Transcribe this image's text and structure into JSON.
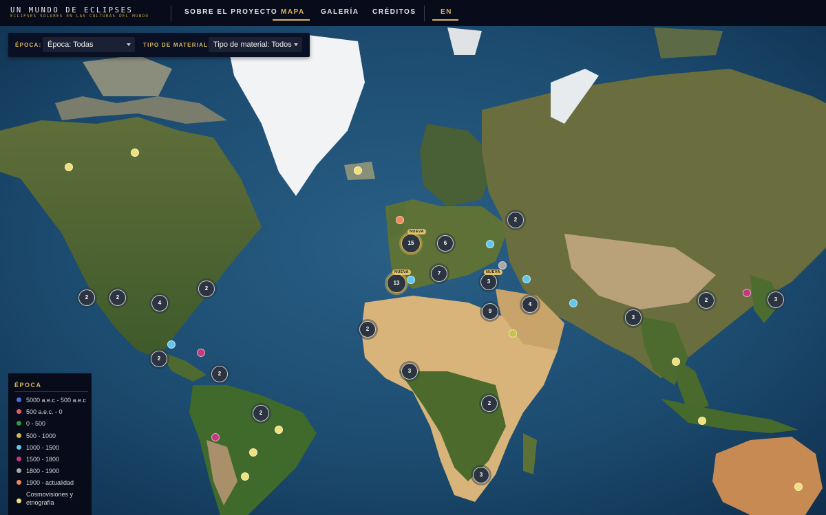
{
  "header": {
    "title": "UN MUNDO DE ECLIPSES",
    "subtitle": "ECLIPSES SOLARES EN LAS CULTURAS DEL MUNDO",
    "nav": {
      "about": "SOBRE EL PROYECTO",
      "map": "MAPA",
      "gallery": "GALERÍA",
      "credits": "CRÉDITOS",
      "lang": "EN"
    }
  },
  "filters": {
    "epoch_label": "ÉPOCA:",
    "epoch_value": "Época: Todas",
    "material_label": "TIPO DE MATERIAL:",
    "material_value": "Tipo de material: Todos"
  },
  "legend": {
    "title": "ÉPOCA",
    "items": [
      {
        "label": "5000 a.e.c - 500 a.e.c",
        "color": "#4a6fd6"
      },
      {
        "label": "500 a.e.c. - 0",
        "color": "#e0606a"
      },
      {
        "label": "0 - 500",
        "color": "#2f9a3b"
      },
      {
        "label": "500 - 1000",
        "color": "#c8c048"
      },
      {
        "label": "1000 - 1500",
        "color": "#62c7ef"
      },
      {
        "label": "1500 - 1800",
        "color": "#c03a7e"
      },
      {
        "label": "1800 - 1900",
        "color": "#a8a8a8"
      },
      {
        "label": "1900 - actualidad",
        "color": "#ee8a5a"
      },
      {
        "label": "Cosmovisiones y etnografía",
        "color": "#efe07a"
      }
    ]
  },
  "clusters": {
    "c1": "2",
    "c2": "2",
    "c3": "4",
    "c4": "2",
    "c5": "2",
    "c6": "2",
    "c7": "2",
    "c8": "15",
    "c9": "6",
    "c10": "13",
    "c11": "7",
    "c12": "3",
    "c13": "2",
    "c14": "4",
    "c15": "9",
    "c16": "2",
    "c17": "3",
    "c18": "2",
    "c19": "3",
    "c20": "2",
    "c21": "3",
    "c22": "2",
    "c23": "3",
    "new_badge": "NUEVA"
  }
}
